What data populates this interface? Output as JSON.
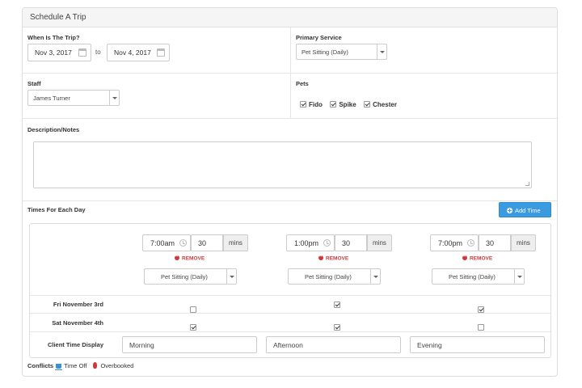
{
  "panel": {
    "title": "Schedule A Trip"
  },
  "trip": {
    "when_label": "When Is The Trip?",
    "start_date": "Nov 3, 2017",
    "to_label": "to",
    "end_date": "Nov 4, 2017"
  },
  "primary_service": {
    "label": "Primary Service",
    "value": "Pet Sitting (Daily)"
  },
  "staff": {
    "label": "Staff",
    "value": "James Turner"
  },
  "pets": {
    "label": "Pets",
    "items": [
      {
        "name": "Fido",
        "checked": true
      },
      {
        "name": "Spike",
        "checked": true
      },
      {
        "name": "Chester",
        "checked": true
      }
    ]
  },
  "description": {
    "label": "Description/Notes",
    "value": ""
  },
  "times": {
    "label": "Times For Each Day",
    "add_button": "Add Time",
    "remove_label": "REMOVE",
    "mins_label": "mins",
    "slots": [
      {
        "time": "7:00am",
        "mins": "30",
        "service": "Pet Sitting (Daily)",
        "display": "Morning"
      },
      {
        "time": "1:00pm",
        "mins": "30",
        "service": "Pet Sitting (Daily)",
        "display": "Afternoon"
      },
      {
        "time": "7:00pm",
        "mins": "30",
        "service": "Pet Sitting (Daily)",
        "display": "Evening"
      }
    ],
    "days": [
      {
        "label": "Fri November 3rd",
        "checks": [
          false,
          true,
          true
        ]
      },
      {
        "label": "Sat November 4th",
        "checks": [
          true,
          true,
          false
        ]
      }
    ],
    "client_display_label": "Client Time Display"
  },
  "conflicts": {
    "label": "Conflicts",
    "time_off": "Time Off",
    "overbooked": "Overbooked"
  },
  "colors": {
    "accent": "#3a9be0",
    "danger": "#d0363b",
    "time_off_icon": "#3a8fd9"
  }
}
